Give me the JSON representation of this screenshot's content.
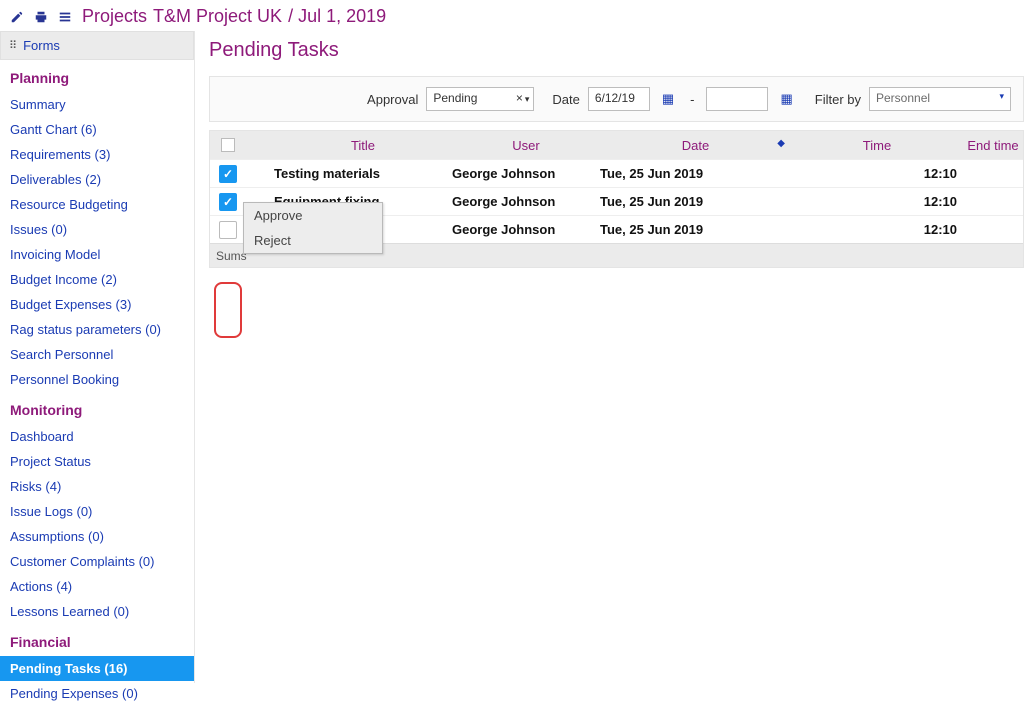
{
  "breadcrumb": {
    "a": "Projects",
    "b": "T&M Project UK",
    "c": "/ Jul 1, 2019"
  },
  "sidebar": {
    "forms_label": "Forms",
    "groups": [
      {
        "title": "Planning",
        "items": [
          "Summary",
          "Gantt Chart (6)",
          "Requirements (3)",
          "Deliverables (2)",
          "Resource Budgeting",
          "Issues (0)",
          "Invoicing Model",
          "Budget Income (2)",
          "Budget Expenses (3)",
          "Rag status parameters (0)",
          "Search Personnel",
          "Personnel Booking"
        ]
      },
      {
        "title": "Monitoring",
        "items": [
          "Dashboard",
          "Project Status",
          "Risks (4)",
          "Issue Logs (0)",
          "Assumptions (0)",
          "Customer Complaints (0)",
          "Actions (4)",
          "Lessons Learned (0)"
        ]
      },
      {
        "title": "Financial",
        "items": [
          "Pending Tasks (16)",
          "Pending Expenses (0)"
        ]
      }
    ],
    "active": "Pending Tasks (16)"
  },
  "page_title": "Pending Tasks",
  "filters": {
    "approval_label": "Approval",
    "approval_value": "Pending",
    "date_label": "Date",
    "date_value": "6/12/19",
    "dash": "-",
    "filterby_label": "Filter by",
    "filterby_value": "Personnel"
  },
  "columns": {
    "title": "Title",
    "user": "User",
    "date": "Date",
    "time": "Time",
    "endtime": "End time"
  },
  "rows": [
    {
      "checked": true,
      "title": "Testing materials",
      "user": "George Johnson",
      "date": "Tue, 25 Jun 2019",
      "time": "12:10"
    },
    {
      "checked": true,
      "title": "Equipment fixing",
      "user": "George Johnson",
      "date": "Tue, 25 Jun 2019",
      "time": "12:10"
    },
    {
      "checked": false,
      "title": "",
      "user": "George Johnson",
      "date": "Tue, 25 Jun 2019",
      "time": "12:10"
    }
  ],
  "sums": "Sums",
  "context_menu": {
    "approve": "Approve",
    "reject": "Reject"
  }
}
